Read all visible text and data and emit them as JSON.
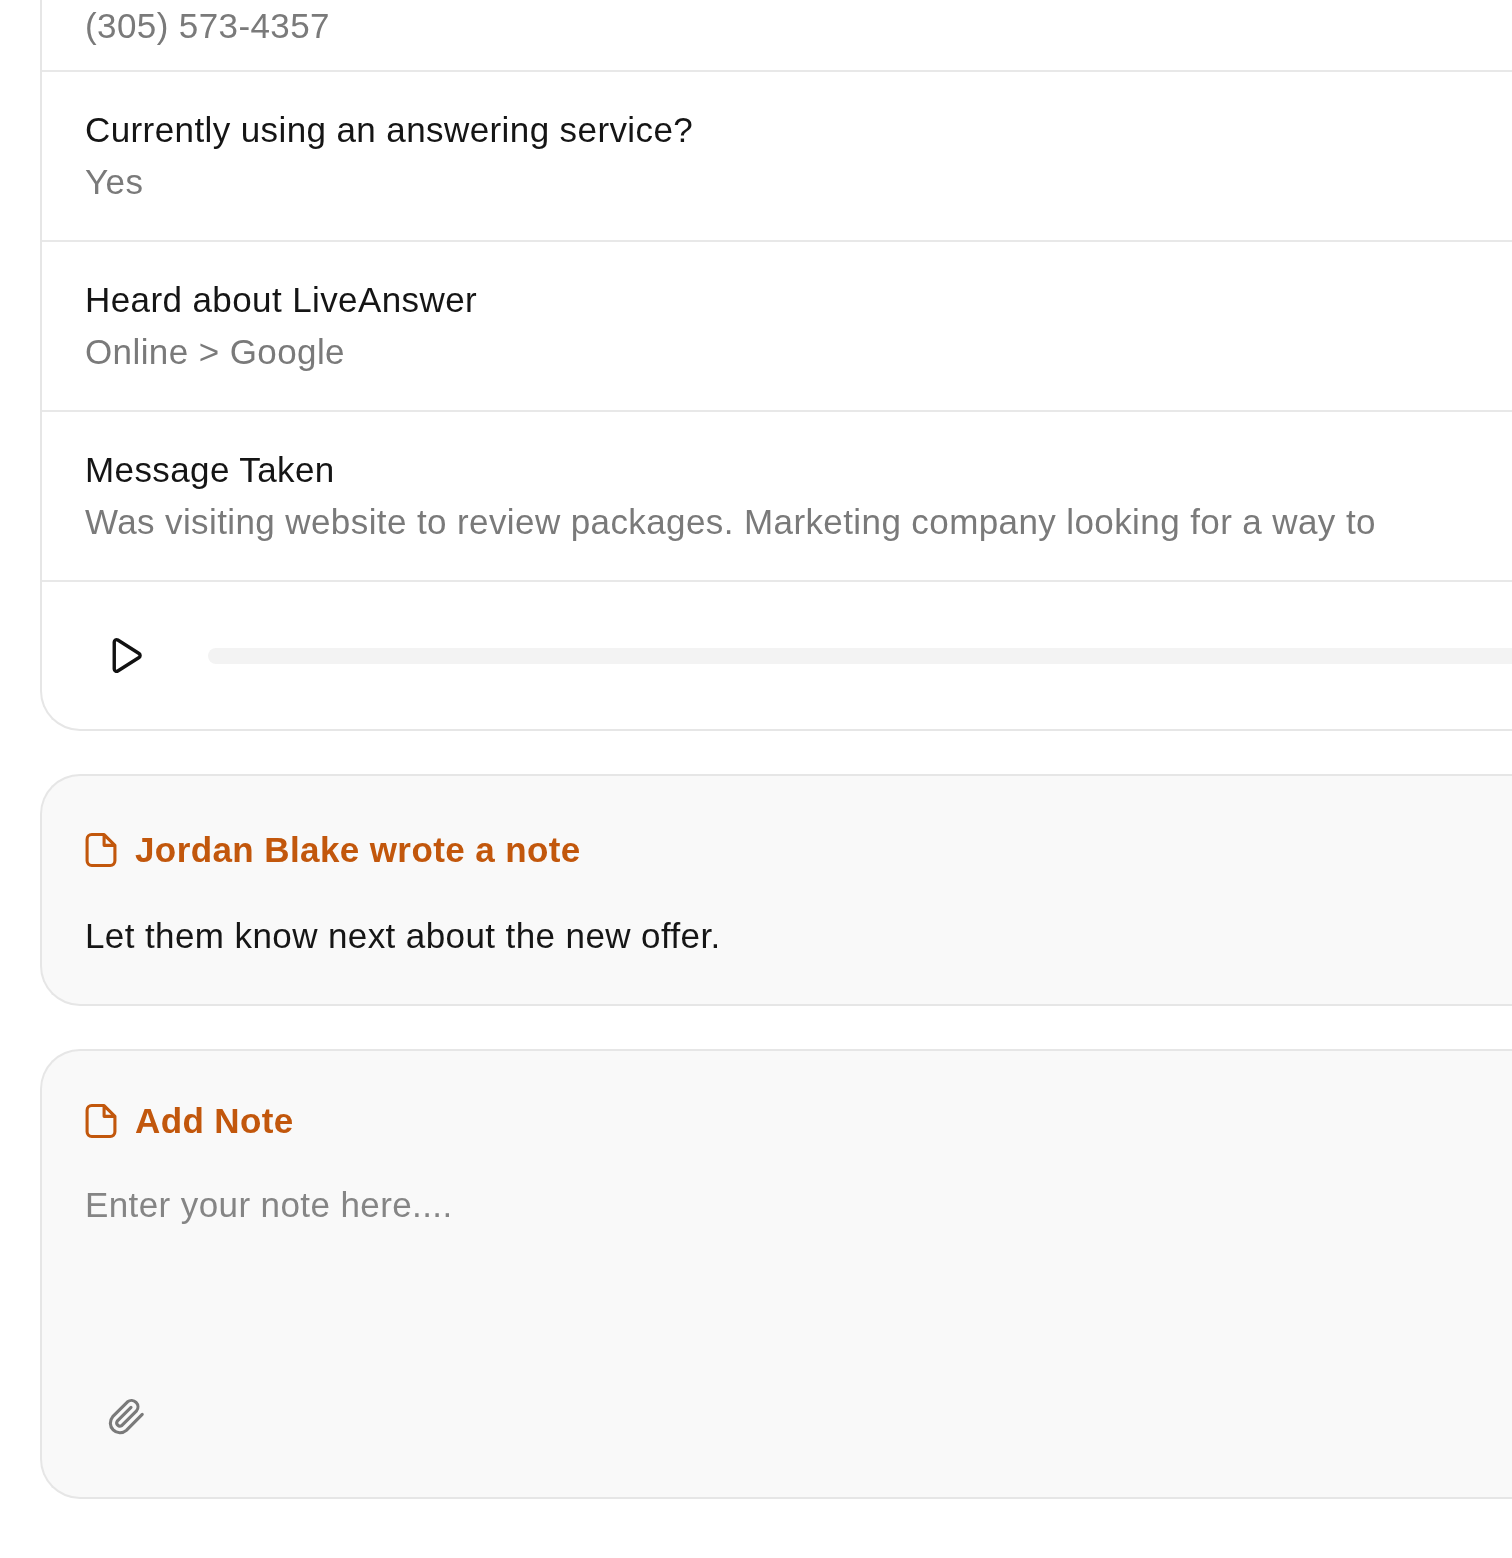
{
  "details_card": {
    "fields": [
      {
        "value": "(305) 573-4357"
      },
      {
        "label": "Currently using an answering service?",
        "value": "Yes"
      },
      {
        "label": "Heard about LiveAnswer",
        "value": "Online > Google"
      },
      {
        "label": "Message Taken",
        "value": "Was visiting website to review packages. Marketing company looking for a way to"
      }
    ]
  },
  "notes": [
    {
      "heading": "Jordan Blake wrote a note",
      "body": "Let them know next about the new offer."
    }
  ],
  "add_note": {
    "heading": "Add Note",
    "placeholder": "Enter your note here...."
  }
}
